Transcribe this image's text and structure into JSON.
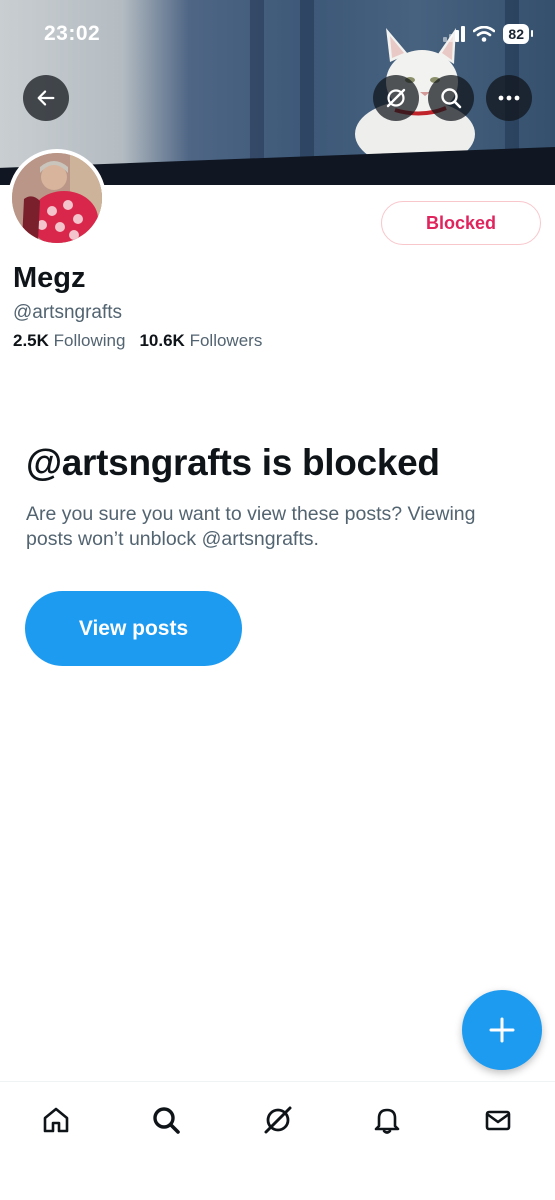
{
  "status_bar": {
    "time": "23:02",
    "battery": "82"
  },
  "header": {
    "back_icon": "arrow-left-icon",
    "grok_icon": "grok-icon",
    "search_icon": "search-icon",
    "more_icon": "more-horizontal-icon"
  },
  "profile": {
    "name": "Megz",
    "handle": "@artsngrafts",
    "following_count": "2.5K",
    "following_label": "Following",
    "followers_count": "10.6K",
    "followers_label": "Followers",
    "blocked_button_label": "Blocked"
  },
  "blocked_notice": {
    "title": "@artsngrafts is blocked",
    "description": "Are you sure you want to view these posts? Viewing posts won’t unblock @artsngrafts.",
    "view_button_label": "View posts"
  },
  "fab": {
    "icon": "plus-icon"
  },
  "bottom_nav": {
    "items": [
      {
        "icon": "home-icon"
      },
      {
        "icon": "search-icon"
      },
      {
        "icon": "grok-icon"
      },
      {
        "icon": "bell-icon"
      },
      {
        "icon": "mail-icon"
      }
    ]
  },
  "colors": {
    "accent": "#1d9bf0",
    "blocked_red": "#e0245e",
    "text_primary": "#0f1419",
    "text_secondary": "#536471"
  }
}
